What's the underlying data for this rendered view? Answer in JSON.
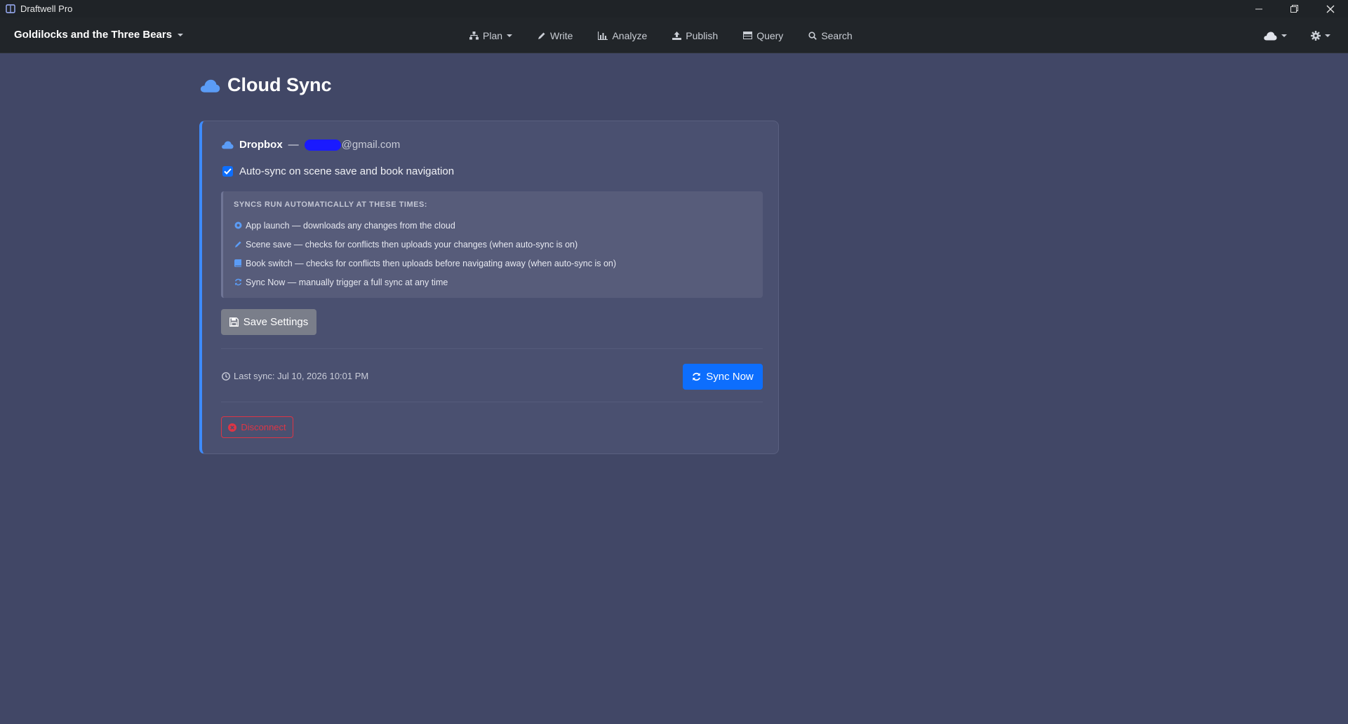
{
  "window": {
    "title": "Draftwell Pro",
    "icon": "book-icon"
  },
  "navbar": {
    "book_title": "Goldilocks and the Three Bears",
    "items": [
      {
        "label": "Plan",
        "icon": "sitemap-icon",
        "has_dropdown": true
      },
      {
        "label": "Write",
        "icon": "pencil-icon",
        "has_dropdown": false
      },
      {
        "label": "Analyze",
        "icon": "bar-chart-icon",
        "has_dropdown": false
      },
      {
        "label": "Publish",
        "icon": "upload-icon",
        "has_dropdown": false
      },
      {
        "label": "Query",
        "icon": "table-icon",
        "has_dropdown": false
      },
      {
        "label": "Search",
        "icon": "search-icon",
        "has_dropdown": false
      }
    ],
    "right": [
      {
        "icon": "cloud-icon",
        "has_dropdown": true
      },
      {
        "icon": "gear-icon",
        "has_dropdown": true
      }
    ]
  },
  "page": {
    "title": "Cloud Sync",
    "title_icon": "cloud-icon"
  },
  "card": {
    "provider": "Dropbox",
    "separator": "—",
    "email_suffix": "@gmail.com",
    "autosync_label": "Auto-sync on scene save and book navigation",
    "autosync_checked": true,
    "info_heading": "SYNCS RUN AUTOMATICALLY AT THESE TIMES:",
    "info_items": [
      {
        "icon": "power-icon",
        "text": "App launch — downloads any changes from the cloud"
      },
      {
        "icon": "pencil-icon",
        "text": "Scene save — checks for conflicts then uploads your changes (when auto-sync is on)"
      },
      {
        "icon": "book-icon",
        "text": "Book switch — checks for conflicts then uploads before navigating away (when auto-sync is on)"
      },
      {
        "icon": "refresh-icon",
        "text": "Sync Now — manually trigger a full sync at any time"
      }
    ],
    "save_label": "Save Settings",
    "last_sync": "Last sync: Jul 10, 2026 10:01 PM",
    "sync_now_label": "Sync Now",
    "disconnect_label": "Disconnect"
  },
  "colors": {
    "background": "#414766",
    "navbar": "#212529",
    "primary": "#0d6efd",
    "danger": "#dc3545",
    "accent_cloud": "#5b9cf6"
  }
}
